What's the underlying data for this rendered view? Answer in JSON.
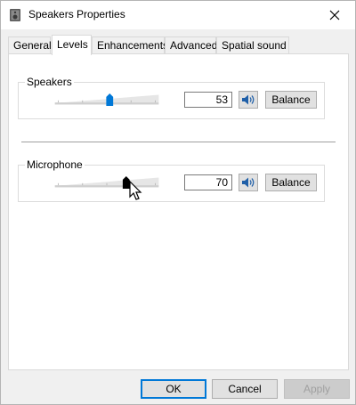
{
  "window": {
    "title": "Speakers Properties"
  },
  "tabs": [
    {
      "label": "General",
      "active": false
    },
    {
      "label": "Levels",
      "active": true
    },
    {
      "label": "Enhancements",
      "active": false
    },
    {
      "label": "Advanced",
      "active": false
    },
    {
      "label": "Spatial sound",
      "active": false
    }
  ],
  "speakers": {
    "label": "Speakers",
    "value": "53",
    "level": 53,
    "balance_label": "Balance",
    "icon": "speaker-icon"
  },
  "microphone": {
    "label": "Microphone",
    "value": "70",
    "level": 70,
    "balance_label": "Balance",
    "icon": "speaker-icon"
  },
  "footer": {
    "ok_label": "OK",
    "cancel_label": "Cancel",
    "apply_label": "Apply"
  },
  "colors": {
    "accent": "#0078d7",
    "thumb_active": "#0078d7",
    "thumb_focus": "#000000"
  }
}
